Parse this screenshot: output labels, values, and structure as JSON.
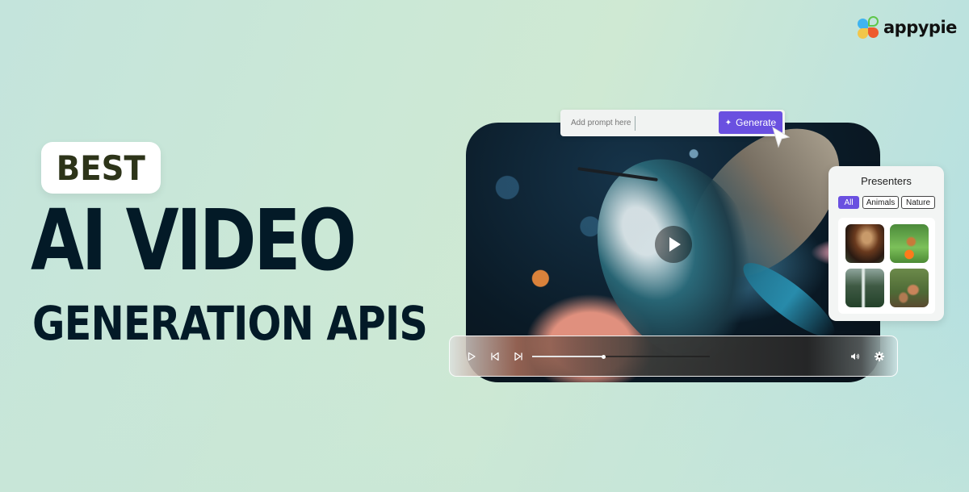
{
  "brand": {
    "name": "appypie",
    "logo_colors": [
      "#3fb4f0",
      "#5fc64a",
      "#f2c64a",
      "#ee5a2d"
    ]
  },
  "headline": {
    "badge": "BEST",
    "line1": "AI VIDEO",
    "line2": "GENERATION APIS"
  },
  "prompt": {
    "placeholder": "Add prompt here",
    "value": "",
    "generate_label": "Generate",
    "generate_icon": "sparkle-icon",
    "accent_color": "#6a50e0"
  },
  "video": {
    "subject": "hummingbird with flowers",
    "play_icon": "play-icon"
  },
  "presenters": {
    "title": "Presenters",
    "filters": [
      {
        "label": "All",
        "active": true
      },
      {
        "label": "Animals",
        "active": false
      },
      {
        "label": "Nature",
        "active": false
      }
    ],
    "thumbnails": [
      {
        "subject": "eagle"
      },
      {
        "subject": "butterfly"
      },
      {
        "subject": "waterfall"
      },
      {
        "subject": "foxes"
      }
    ]
  },
  "player": {
    "controls": [
      "play-icon",
      "skip-previous-icon",
      "skip-next-icon",
      "volume-icon",
      "settings-icon"
    ],
    "progress_fraction": 0.4
  }
}
